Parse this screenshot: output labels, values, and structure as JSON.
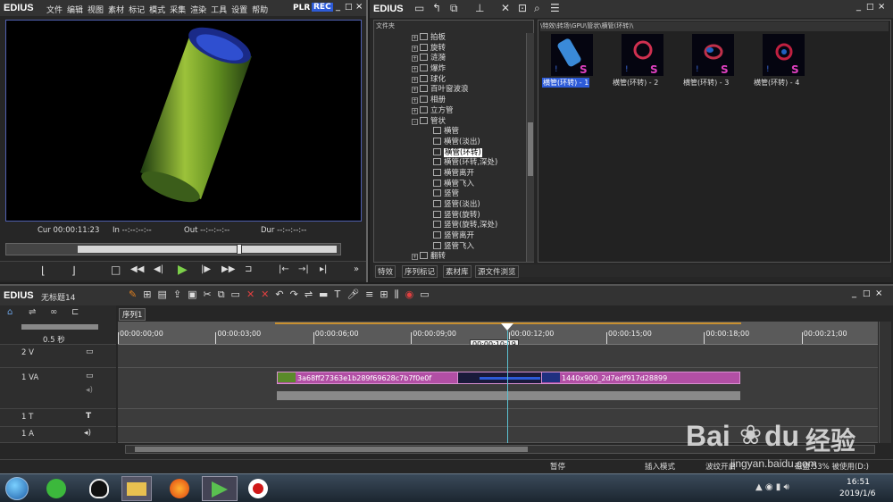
{
  "app": {
    "name": "EDIUS",
    "menu": [
      "文件",
      "编辑",
      "视图",
      "素材",
      "标记",
      "模式",
      "采集",
      "渲染",
      "工具",
      "设置",
      "帮助"
    ],
    "plr": "PLR",
    "rec": "REC"
  },
  "player": {
    "cur": "Cur 00:00:11:23",
    "in": "In --:--:--:--",
    "out": "Out --:--:--:--",
    "dur": "Dur --:--:--:--"
  },
  "bin": {
    "folder_label": "文件夹",
    "path": "\\特效\\转场\\GPU\\管状\\横管(环转)\\",
    "tree": [
      {
        "label": "拍板",
        "indent": 0,
        "exp": "+"
      },
      {
        "label": "旋转",
        "indent": 0,
        "exp": "+"
      },
      {
        "label": "涟漪",
        "indent": 0,
        "exp": "+"
      },
      {
        "label": "爆炸",
        "indent": 0,
        "exp": "+"
      },
      {
        "label": "球化",
        "indent": 0,
        "exp": "+"
      },
      {
        "label": "百叶窗波浪",
        "indent": 0,
        "exp": "+"
      },
      {
        "label": "相册",
        "indent": 0,
        "exp": "+"
      },
      {
        "label": "立方管",
        "indent": 0,
        "exp": "+"
      },
      {
        "label": "管状",
        "indent": 0,
        "exp": "-"
      },
      {
        "label": "横管",
        "indent": 1
      },
      {
        "label": "横管(淡出)",
        "indent": 1
      },
      {
        "label": "横管(环转)",
        "indent": 1,
        "selected": true
      },
      {
        "label": "横管(环转,深处)",
        "indent": 1
      },
      {
        "label": "横管离开",
        "indent": 1
      },
      {
        "label": "横管飞入",
        "indent": 1
      },
      {
        "label": "竖管",
        "indent": 1
      },
      {
        "label": "竖管(淡出)",
        "indent": 1
      },
      {
        "label": "竖管(旋转)",
        "indent": 1
      },
      {
        "label": "竖管(旋转,深处)",
        "indent": 1
      },
      {
        "label": "竖管离开",
        "indent": 1
      },
      {
        "label": "竖管飞入",
        "indent": 1
      },
      {
        "label": "翻转",
        "indent": 0,
        "exp": "+"
      }
    ],
    "thumbs": [
      "横管(环转) - 1",
      "横管(环转) - 2",
      "横管(环转) - 3",
      "横管(环转) - 4"
    ],
    "tabs": [
      "特效",
      "序列标记",
      "素材库",
      "源文件浏览"
    ]
  },
  "timeline": {
    "project": "无标题14",
    "sequence": "序列1",
    "zoom": "0.5 秒",
    "ruler": [
      "00:00:00;00",
      "00:00:03;00",
      "00:00:06;00",
      "00:00:09;00",
      "00:00:12;00",
      "00:00:15;00",
      "00:00:18;00",
      "00:00:21;00"
    ],
    "cursor_tc": "00:00:10;19",
    "tracks": {
      "v2": "2 V",
      "va1": "1 VA",
      "t1": "1 T",
      "a1": "1 A"
    },
    "clips": {
      "clip1": "3a68ff27363e1b289f69628c7b7f0e0f",
      "clip2": "1440x900_2d7edf917d28899"
    }
  },
  "status": {
    "pause": "暂停",
    "insert": "插入模式",
    "ripple": "波纹开启",
    "disk": "磁盘:53% 被使用(D:)"
  },
  "taskbar": {
    "time": "16:51",
    "date": "2019/1/6"
  },
  "watermark": {
    "brand": "Bai",
    "paw": "du",
    "suffix": "经验",
    "url": "jingyan.baidu.com"
  }
}
